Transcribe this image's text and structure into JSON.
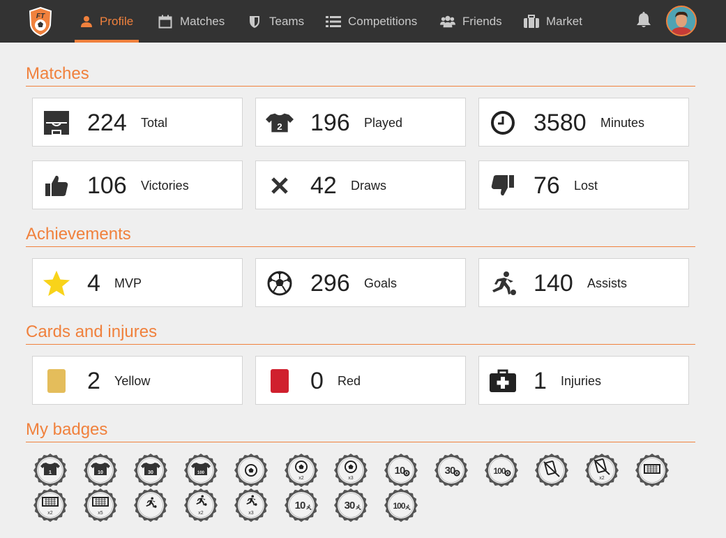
{
  "nav": {
    "items": [
      {
        "label": "Profile",
        "icon": "user-icon",
        "active": true
      },
      {
        "label": "Matches",
        "icon": "calendar-icon",
        "active": false
      },
      {
        "label": "Teams",
        "icon": "shield-icon",
        "active": false
      },
      {
        "label": "Competitions",
        "icon": "list-icon",
        "active": false
      },
      {
        "label": "Friends",
        "icon": "users-icon",
        "active": false
      },
      {
        "label": "Market",
        "icon": "briefcase-icon",
        "active": false
      }
    ]
  },
  "colors": {
    "accent": "#f0813d",
    "nav_bg": "#333333",
    "yellow_card": "#e4bd5b",
    "red_card": "#d0202e",
    "star": "#f8d31a"
  },
  "sections": {
    "matches": "Matches",
    "achievements": "Achievements",
    "cards": "Cards and injures",
    "badges": "My badges"
  },
  "stats": {
    "total": {
      "value": "224",
      "label": "Total",
      "icon": "pitch-icon"
    },
    "played": {
      "value": "196",
      "label": "Played",
      "icon": "shirt-icon",
      "shirt_number": "2"
    },
    "minutes": {
      "value": "3580",
      "label": "Minutes",
      "icon": "clock-icon"
    },
    "victories": {
      "value": "106",
      "label": "Victories",
      "icon": "thumbs-up-icon"
    },
    "draws": {
      "value": "42",
      "label": "Draws",
      "icon": "x-icon"
    },
    "lost": {
      "value": "76",
      "label": "Lost",
      "icon": "thumbs-down-icon"
    },
    "mvp": {
      "value": "4",
      "label": "MVP",
      "icon": "star-icon"
    },
    "goals": {
      "value": "296",
      "label": "Goals",
      "icon": "ball-icon"
    },
    "assists": {
      "value": "140",
      "label": "Assists",
      "icon": "kick-icon"
    },
    "yellow": {
      "value": "2",
      "label": "Yellow",
      "icon": "yellow-card-icon"
    },
    "red": {
      "value": "0",
      "label": "Red",
      "icon": "red-card-icon"
    },
    "injuries": {
      "value": "1",
      "label": "Injuries",
      "icon": "first-aid-icon"
    }
  },
  "badges": [
    {
      "kind": "shirt",
      "text": "1",
      "sub": ""
    },
    {
      "kind": "shirt",
      "text": "10",
      "sub": ""
    },
    {
      "kind": "shirt",
      "text": "30",
      "sub": ""
    },
    {
      "kind": "shirt",
      "text": "100",
      "sub": ""
    },
    {
      "kind": "ball",
      "text": "",
      "sub": ""
    },
    {
      "kind": "ball",
      "text": "",
      "sub": "x2"
    },
    {
      "kind": "ball",
      "text": "",
      "sub": "x3"
    },
    {
      "kind": "count-ball",
      "text": "10",
      "sub": ""
    },
    {
      "kind": "count-ball",
      "text": "30",
      "sub": ""
    },
    {
      "kind": "count-ball",
      "text": "100",
      "sub": ""
    },
    {
      "kind": "nocard",
      "text": "",
      "sub": ""
    },
    {
      "kind": "nocard",
      "text": "",
      "sub": "x2"
    },
    {
      "kind": "goal",
      "text": "",
      "sub": ""
    },
    {
      "kind": "goal",
      "text": "",
      "sub": "x2"
    },
    {
      "kind": "goal",
      "text": "",
      "sub": "x5"
    },
    {
      "kind": "kick",
      "text": "",
      "sub": ""
    },
    {
      "kind": "kick",
      "text": "",
      "sub": "x2"
    },
    {
      "kind": "kick",
      "text": "",
      "sub": "x3"
    },
    {
      "kind": "count-kick",
      "text": "10",
      "sub": ""
    },
    {
      "kind": "count-kick",
      "text": "30",
      "sub": ""
    },
    {
      "kind": "count-kick",
      "text": "100",
      "sub": ""
    }
  ]
}
